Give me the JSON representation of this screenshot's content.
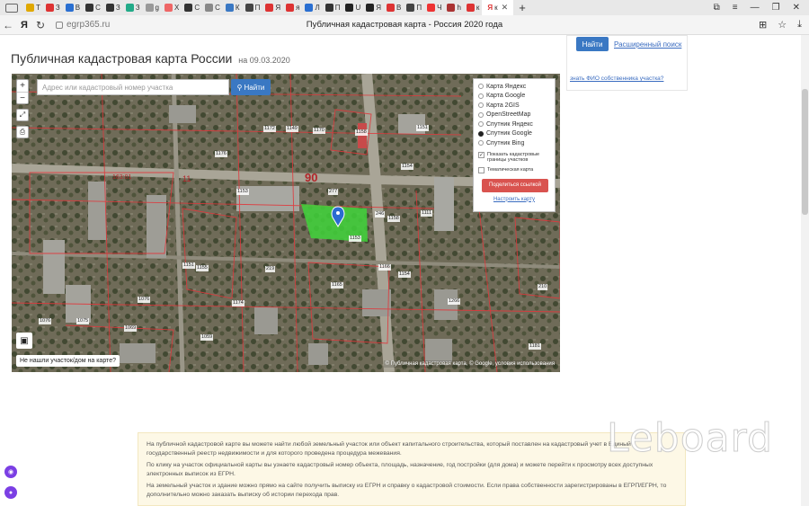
{
  "browser": {
    "tabs": [
      {
        "label": "Т",
        "color": "#e0a800"
      },
      {
        "label": "З",
        "color": "#d33"
      },
      {
        "label": "В",
        "color": "#2a6fd1"
      },
      {
        "label": "С",
        "color": "#333"
      },
      {
        "label": "З",
        "color": "#333"
      },
      {
        "label": "З",
        "color": "#2a8"
      },
      {
        "label": "g",
        "color": "#999"
      },
      {
        "label": "Х",
        "color": "#e66"
      },
      {
        "label": "С",
        "color": "#333"
      },
      {
        "label": "С",
        "color": "#888"
      },
      {
        "label": "К",
        "color": "#3a78c3"
      },
      {
        "label": "П",
        "color": "#444"
      },
      {
        "label": "Я",
        "color": "#d33"
      },
      {
        "label": "я",
        "color": "#d33"
      },
      {
        "label": "Л",
        "color": "#2a6fd1"
      },
      {
        "label": "П",
        "color": "#333"
      },
      {
        "label": "U",
        "color": "#222"
      },
      {
        "label": "Я",
        "color": "#222"
      },
      {
        "label": "В",
        "color": "#d33"
      },
      {
        "label": "П",
        "color": "#444"
      },
      {
        "label": "Ч",
        "color": "#e33"
      },
      {
        "label": "h",
        "color": "#a33"
      },
      {
        "label": "к",
        "color": "#d33"
      }
    ],
    "active_tab_icon": "yandex-icon",
    "url": "egrp365.ru",
    "page_title": "Публичная кадастровая карта - Россия 2020 года",
    "yandex_logo": "Я"
  },
  "page": {
    "heading": "Публичная кадастровая карта России",
    "date": "на 09.03.2020",
    "find_button": "Найти",
    "advanced_search": "Расширенный поиск",
    "owner_link": "знать ФИО собственника участка?"
  },
  "map": {
    "search_placeholder": "Адрес или кадастровый номер участка",
    "search_button": "Найти",
    "layers": [
      {
        "label": "Карта Яндекс",
        "selected": false
      },
      {
        "label": "Карта Google",
        "selected": false
      },
      {
        "label": "Карта 2GIS",
        "selected": false
      },
      {
        "label": "OpenStreetMap",
        "selected": false
      },
      {
        "label": "Спутник Яндекс",
        "selected": false
      },
      {
        "label": "Спутник Google",
        "selected": true
      },
      {
        "label": "Спутник Bing",
        "selected": false
      }
    ],
    "show_borders_label": "Показать кадастровые границы участков",
    "thematic_label": "Тематическая карта",
    "share_button": "Поделиться ссылкой",
    "settings_link": "Настроить карту",
    "not_found": "Не нашли участок/дом на карте?",
    "attribution": "© Публичная кадастровая карта, © Google, условия использования",
    "quarter_90": "90",
    "quarter_11": "11",
    "quarter_163": "163:01",
    "parcel_labels": [
      "1172",
      "1149",
      "1170",
      "1158",
      "1176",
      "1154",
      "1151",
      "1153",
      "277",
      "1111",
      "1151",
      "1155",
      "1174",
      "1166",
      "1153",
      "1158",
      "1076",
      "1075",
      "1069",
      "1059",
      "1165",
      "1154",
      "246",
      "1266",
      "210",
      "219",
      "1076",
      "1181"
    ]
  },
  "info": {
    "p1": "На публичной кадастровой карте вы можете найти любой земельный участок или объект капитального строительства, который поставлен на кадастровый учет в Единый государственный реестр недвижимости и для которого проведена процедура межевания.",
    "p2": "По клику на участок официальной карты вы узнаете кадастровый номер объекта, площадь, назначение, год постройки (для дома) и можете перейти к просмотру всех доступных электронных выписок из ЕГРН.",
    "p3": "На земельный участок и здание можно прямо на сайте получить выписку из ЕГРН и справку о кадастровой стоимости. Если права собственности зарегистрированы в ЕГРП/ЕГРН, то дополнительно можно заказать выписку об истории перехода прав."
  },
  "watermark": "Leboard"
}
